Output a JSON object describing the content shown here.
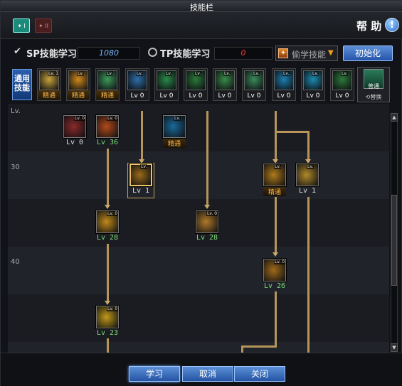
{
  "window": {
    "title": "技能栏"
  },
  "header": {
    "page_tabs": [
      {
        "label": "✦ I",
        "active": true
      },
      {
        "label": "✦ II",
        "active": false
      }
    ],
    "help_label": "帮 助",
    "help_icon": "!"
  },
  "points": {
    "sp_label": "SP技能学习",
    "sp_value": "1080",
    "tp_label": "TP技能学习",
    "tp_value": "0",
    "steal_icon": "✦",
    "steal_label": "偷学技能",
    "init_label": "初始化"
  },
  "general": {
    "label": "通用技能",
    "skills": [
      {
        "tag": "Lv. 1",
        "label": "精通",
        "master": true,
        "icon": "skill-a-icon",
        "color": "#c9a33b"
      },
      {
        "tag": "Lv.",
        "label": "精通",
        "master": true,
        "icon": "skill-b-icon",
        "color": "#d08a1a"
      },
      {
        "tag": "Lv.",
        "label": "精通",
        "master": true,
        "icon": "skill-c-icon",
        "color": "#3e9a5a"
      },
      {
        "tag": "Lv.",
        "label": "Lv 0",
        "master": false,
        "icon": "skill-d-icon",
        "color": "#2e6fa8"
      },
      {
        "tag": "Lv.",
        "label": "Lv 0",
        "master": false,
        "icon": "skill-e-icon",
        "color": "#2a8a4a"
      },
      {
        "tag": "Lv.",
        "label": "Lv 0",
        "master": false,
        "icon": "skill-f-icon",
        "color": "#2a7a3a"
      },
      {
        "tag": "Lv.",
        "label": "Lv 0",
        "master": false,
        "icon": "skill-g-icon",
        "color": "#3a8a4a"
      },
      {
        "tag": "Lv.",
        "label": "Lv 0",
        "master": false,
        "icon": "skill-h-icon",
        "color": "#3a8a5a"
      },
      {
        "tag": "Lv.",
        "label": "Lv 0",
        "master": false,
        "icon": "skill-i-icon",
        "color": "#1e7fb0"
      },
      {
        "tag": "Lv.",
        "label": "Lv 0",
        "master": false,
        "icon": "skill-j-icon",
        "color": "#1e8ab0"
      },
      {
        "tag": "Lv.",
        "label": "Lv 0",
        "master": false,
        "icon": "skill-k-icon",
        "color": "#2c7a3a"
      }
    ],
    "swap_tag": "普通",
    "swap_label": "⟲替换"
  },
  "tree": {
    "level_labels": [
      "Lv.",
      "30",
      "40"
    ],
    "skills": [
      {
        "id": "s1",
        "tag": "Lv. 0",
        "label": "Lv 0",
        "style": "plain",
        "color": "#8a2a2a"
      },
      {
        "id": "s2",
        "tag": "Lv. 0",
        "label": "Lv 36",
        "style": "green",
        "color": "#b24a1a"
      },
      {
        "id": "s3",
        "tag": "Lv.",
        "label": "精通",
        "style": "master",
        "color": "#1a6a9a"
      },
      {
        "id": "s4",
        "tag": "Lv.",
        "label": "Lv 1",
        "style": "plain",
        "color": "#9a6a1a"
      },
      {
        "id": "s5",
        "tag": "Lv.",
        "label": "精通",
        "style": "master",
        "color": "#b07a1a"
      },
      {
        "id": "s6",
        "tag": "Lv.",
        "label": "Lv 1",
        "style": "plain",
        "color": "#b08a2a"
      },
      {
        "id": "s7",
        "tag": "Lv. 0",
        "label": "Lv 28",
        "style": "green",
        "color": "#c08a1a"
      },
      {
        "id": "s8",
        "tag": "Lv. 0",
        "label": "Lv 28",
        "style": "green",
        "color": "#b07a2a"
      },
      {
        "id": "s9",
        "tag": "Lv. 0",
        "label": "Lv 26",
        "style": "green",
        "color": "#a06a1a"
      },
      {
        "id": "s10",
        "tag": "Lv. 0",
        "label": "Lv 23",
        "style": "green",
        "color": "#c09a1a"
      }
    ]
  },
  "footer": {
    "learn_label": "学习",
    "cancel_label": "取消",
    "close_label": "关闭"
  }
}
